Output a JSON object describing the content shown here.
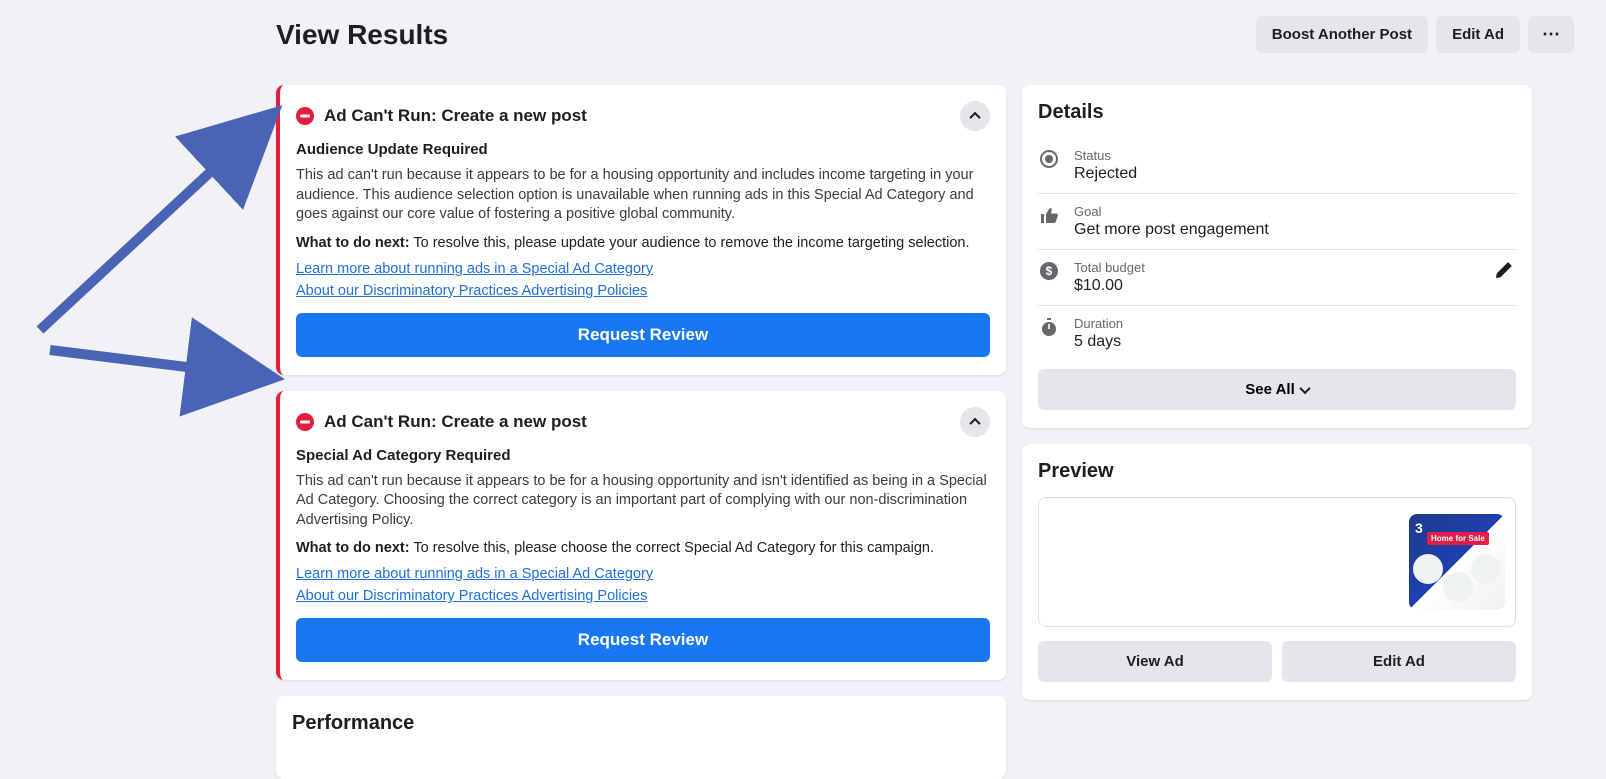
{
  "header": {
    "title": "View Results",
    "boost_label": "Boost Another Post",
    "edit_label": "Edit Ad"
  },
  "alerts": [
    {
      "title": "Ad Can't Run: Create a new post",
      "subtitle": "Audience Update Required",
      "body": "This ad can't run because it appears to be for a housing opportunity and includes income targeting in your audience. This audience selection option is unavailable when running ads in this Special Ad Category and goes against our core value of fostering a positive global community.",
      "next_label": "What to do next:",
      "next_text": " To resolve this, please update your audience to remove the income targeting selection.",
      "link1": "Learn more about running ads in a Special Ad Category",
      "link2": "About our Discriminatory Practices Advertising Policies",
      "button": "Request Review"
    },
    {
      "title": "Ad Can't Run: Create a new post",
      "subtitle": "Special Ad Category Required",
      "body": "This ad can't run because it appears to be for a housing opportunity and isn't identified as being in a Special Ad Category. Choosing the correct category is an important part of complying with our non-discrimination Advertising Policy.",
      "next_label": "What to do next:",
      "next_text": " To resolve this, please choose the correct Special Ad Category for this campaign.",
      "link1": "Learn more about running ads in a Special Ad Category",
      "link2": "About our Discriminatory Practices Advertising Policies",
      "button": "Request Review"
    }
  ],
  "details": {
    "heading": "Details",
    "status_label": "Status",
    "status_value": "Rejected",
    "goal_label": "Goal",
    "goal_value": "Get more post engagement",
    "budget_label": "Total budget",
    "budget_value": "$10.00",
    "duration_label": "Duration",
    "duration_value": "5 days",
    "see_all": "See All"
  },
  "preview": {
    "heading": "Preview",
    "thumb_num": "3",
    "thumb_tag": "Home for Sale",
    "view_label": "View Ad",
    "edit_label": "Edit Ad"
  },
  "performance": {
    "heading": "Performance"
  }
}
